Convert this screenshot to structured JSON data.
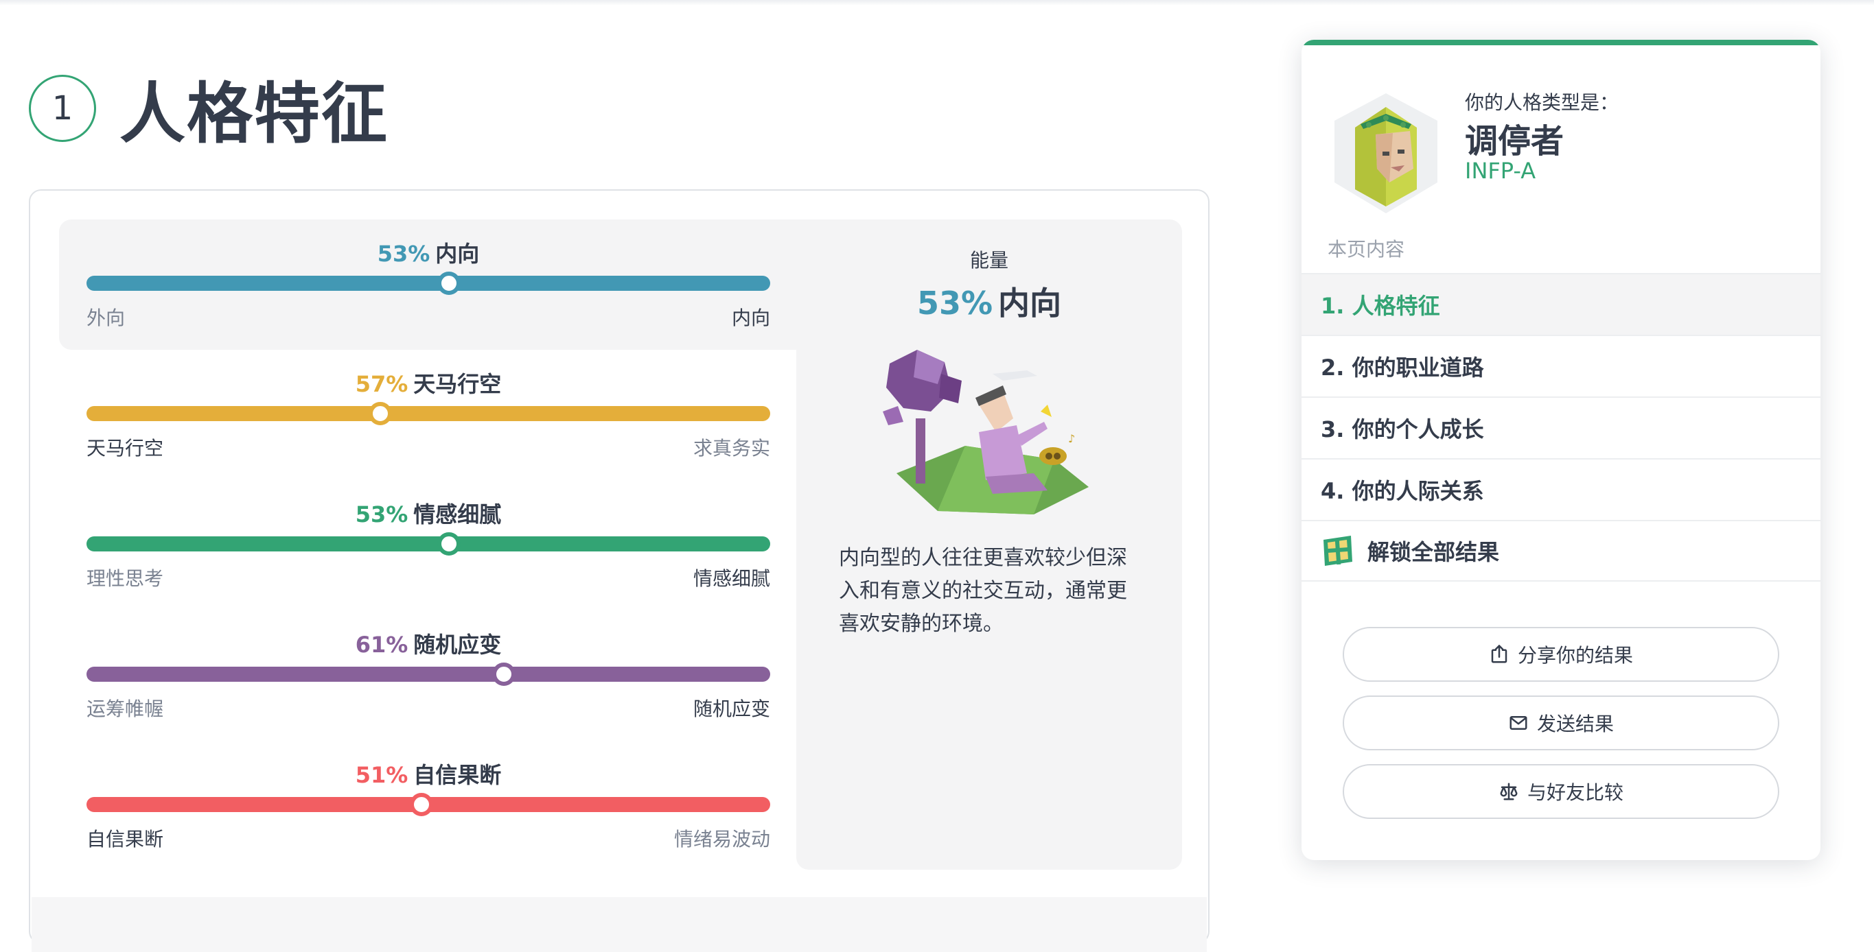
{
  "section": {
    "number": "1",
    "title": "人格特征"
  },
  "traits": [
    {
      "pct": "53%",
      "name": "内向",
      "left": "外向",
      "right": "内向",
      "color": "#4298b4",
      "value": 0.53,
      "highlight": "right"
    },
    {
      "pct": "57%",
      "name": "天马行空",
      "left": "天马行空",
      "right": "求真务实",
      "color": "#e4ae3a",
      "value": 0.43,
      "highlight": "left"
    },
    {
      "pct": "53%",
      "name": "情感细腻",
      "left": "理性思考",
      "right": "情感细腻",
      "color": "#33a474",
      "value": 0.53,
      "highlight": "right"
    },
    {
      "pct": "61%",
      "name": "随机应变",
      "left": "运筹帷幄",
      "right": "随机应变",
      "color": "#88619a",
      "value": 0.61,
      "highlight": "right"
    },
    {
      "pct": "51%",
      "name": "自信果断",
      "left": "自信果断",
      "right": "情绪易波动",
      "color": "#f25e62",
      "value": 0.49,
      "highlight": "left"
    }
  ],
  "detail": {
    "caption": "能量",
    "pct": "53%",
    "name": "内向",
    "description": "内向型的人往往更喜欢较少但深入和有意义的社交互动，通常更喜欢安静的环境。"
  },
  "sidebar": {
    "type_caption": "你的人格类型是：",
    "type_name": "调停者",
    "type_code": "INFP-A",
    "toc_heading": "本页内容",
    "toc": [
      "1. 人格特征",
      "2. 你的职业道路",
      "3. 你的个人成长",
      "4. 你的人际关系"
    ],
    "unlock": "解锁全部结果",
    "buttons": {
      "share": "分享你的结果",
      "send": "发送结果",
      "compare": "与好友比较"
    }
  },
  "colors": {
    "accent": "#33a474",
    "text": "#343c4b",
    "muted": "#7a8291"
  }
}
